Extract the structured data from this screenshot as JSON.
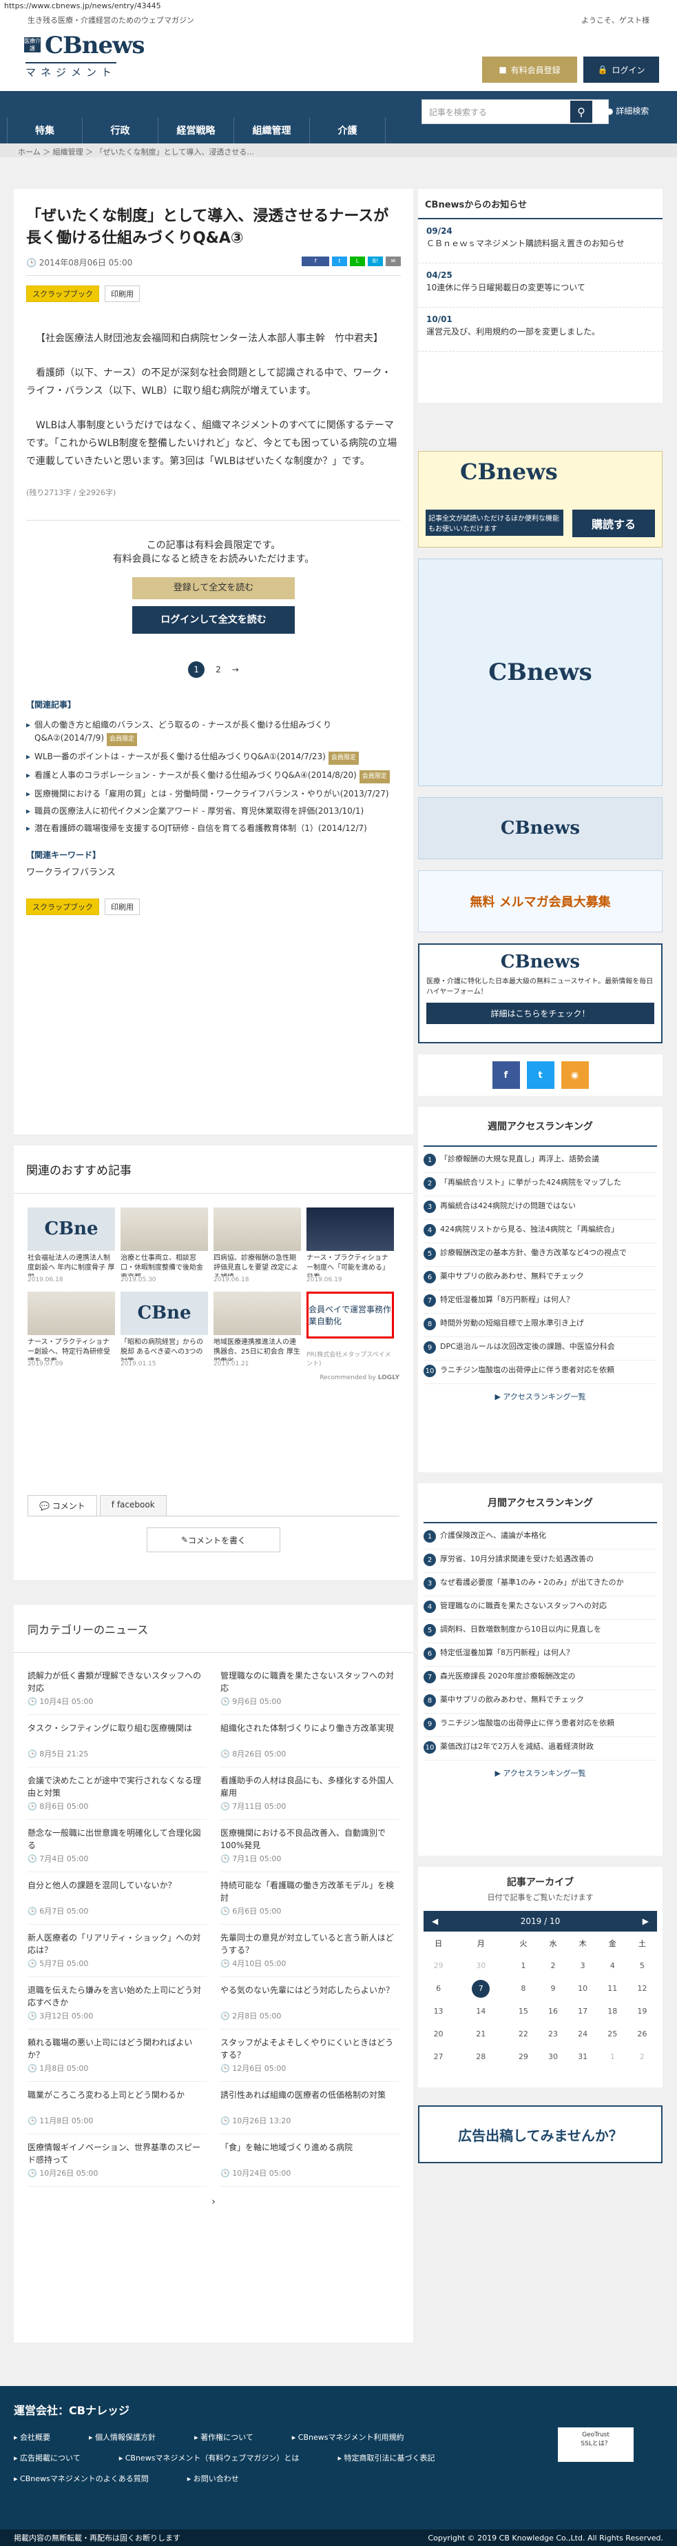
{
  "url": "https://www.cbnews.jp/news/entry/43445",
  "top": {
    "tagline": "生き残る医療・介護経営のためのウェブマガジン",
    "welcome": "ようこそ、ゲスト様"
  },
  "logo": {
    "badge": "医療介護",
    "name": "CBnews",
    "sub": "マネジメント"
  },
  "header": {
    "register": "有料会員登録",
    "login": "ログイン"
  },
  "nav": [
    "特集",
    "行政",
    "経営戦略",
    "組織管理",
    "介護"
  ],
  "search": {
    "placeholder": "記事を検索する",
    "advanced": "詳細検索"
  },
  "breadcrumb": "ホーム ＞ 組織管理 ＞ 「ぜいたくな制度」として導入、浸透させる...",
  "article": {
    "title": "「ぜいたくな制度」として導入、浸透させるナースが長く働ける仕組みづくりQ&A③",
    "date": "2014年08月06日 05:00",
    "scrap": "スクラップブック",
    "print": "印刷用",
    "author": "【社会医療法人財団池友会福岡和白病院センター法人本部人事主幹　竹中君夫】",
    "p1": "看護師（以下、ナース）の不足が深刻な社会問題として認識される中で、ワーク・ライフ・バランス（以下、WLB）に取り組む病院が増えています。",
    "p2": "WLBは人事制度というだけではなく、組織マネジメントのすべてに関係するテーマです。「これからWLB制度を整備したいけれど」など、今とても困っている病院の立場で連載していきたいと思います。第3回は「WLBはぜいたくな制度か？」です。",
    "remaining": "(残り2713字 / 全2926字)",
    "lock1": "この記事は有料会員限定です。",
    "lock2": "有料会員になると続きをお読みいただけます。",
    "btn_register": "登録して全文を読む",
    "btn_login": "ログインして全文を読む",
    "pages": [
      "1",
      "2",
      "→"
    ],
    "related_title": "【関連記事】",
    "related": [
      "個人の働き方と組織のバランス、どう取るの - ナースが長く働ける仕組みづくりQ&A②(2014/7/9)",
      "WLB一番のポイントは - ナースが長く働ける仕組みづくりQ&A①(2014/7/23)",
      "看護と人事のコラボレーション - ナースが長く働ける仕組みづくりQ&A④(2014/8/20)",
      "医療機関における「雇用の質」とは - 労働時間・ワークライフバランス・やりがい(2013/7/27)",
      "職員の医療法人に初代イクメン企業アワード - 厚労省、育児休業取得を評価(2013/10/1)",
      "潜在看護師の職場復帰を支援するOJT研修 - 自信を育てる看護教育体制（1）(2014/12/7)"
    ],
    "mini": "会員限定",
    "kw_title": "【関連キーワード】",
    "kw": "ワークライフバランス"
  },
  "rec": {
    "title": "関連のおすすめ記事",
    "items": [
      {
        "t": "社会福祉法人の連携法人制度創設へ 年内に制度骨子 厚労...",
        "d": "2019.06.18"
      },
      {
        "t": "治療と仕事両立、相談窓口・休暇制度整備で後助金 東京都...",
        "d": "2019.05.30"
      },
      {
        "t": "四病協、診療報酬の急性期評価見直しを要望 改定による補填...",
        "d": "2019.06.18"
      },
      {
        "t": "ナース・プラクティショナー制度へ「可能を進める」日看...",
        "d": "2019.06.19"
      },
      {
        "t": "ナース・プラクティショナー創設へ、特定行為研修受講を 日看...",
        "d": "2019.07.09"
      },
      {
        "t": "「昭和の病院経営」からの脱却 あるべき姿への3つの対策...",
        "d": "2019.01.15"
      },
      {
        "t": "地域医療連携推進法人の連携器合、25日に初会合 厚生労働省...",
        "d": "2019.01.21"
      },
      {
        "t": "会員ペイで運営事務作業自動化",
        "d": "PR(株式会社メタップスペイメント)"
      }
    ],
    "logly": "Recommended by"
  },
  "comments": {
    "tab1": "コメント",
    "tab2": "facebook",
    "write": "コメントを書く"
  },
  "news": {
    "title": "同カテゴリーのニュース",
    "items": [
      {
        "t": "読解力が低く書類が理解できないスタッフへの対応",
        "d": "10月4日 05:00"
      },
      {
        "t": "管理職なのに職責を果たさないスタッフへの対応",
        "d": "9月6日 05:00"
      },
      {
        "t": "タスク・シフティングに取り組む医療機関は",
        "d": "8月5日 21:25"
      },
      {
        "t": "組織化された体制づくりにより働き方改革実現",
        "d": "8月26日 05:00"
      },
      {
        "t": "会議で決めたことが途中で実行されなくなる理由と対策",
        "d": "8月6日 05:00"
      },
      {
        "t": "看護助手の人材は良品にも、多様化する外国人雇用",
        "d": "7月11日 05:00"
      },
      {
        "t": "懸念な一般職に出世意識を明確化して合理化図る",
        "d": "7月4日 05:00"
      },
      {
        "t": "医療機関における不良品改善入、自動識別で100%発見",
        "d": "7月1日 05:00"
      },
      {
        "t": "自分と他人の課題を混同していないか？",
        "d": "6月7日 05:00"
      },
      {
        "t": "持続可能な「看護職の働き方改革モデル」を検討",
        "d": "6月6日 05:00"
      },
      {
        "t": "新人医療者の「リアリティ・ショック」への対応は？",
        "d": "5月7日 05:00"
      },
      {
        "t": "先輩同士の意見が対立していると言う新人はどうする？",
        "d": "4月10日 05:00"
      },
      {
        "t": "退職を伝えたら嫌みを言い始めた上司にどう対応すべきか",
        "d": "3月12日 05:00"
      },
      {
        "t": "やる気のない先輩にはどう対応したらよいか？",
        "d": "2月8日 05:00"
      },
      {
        "t": "頼れる職場の悪い上司にはどう関わればよいか？",
        "d": "1月8日 05:00"
      },
      {
        "t": "スタッフがよそよそしくやりにくいときはどうする？",
        "d": "12月6日 05:00"
      },
      {
        "t": "職業がころころ変わる上司とどう関わるか",
        "d": "11月8日 05:00"
      },
      {
        "t": "誘引性あれば組織の医療者の低価格制の対策",
        "d": "10月26日 13:20"
      },
      {
        "t": "医療情報ギイノベーション、世界基準のスピード感持って",
        "d": "10月26日 05:00"
      },
      {
        "t": "「食」を軸に地域づくり進める病院",
        "d": "10月24日 05:00"
      }
    ]
  },
  "notice": {
    "title": "CBnewsからのお知らせ",
    "items": [
      {
        "d": "09/24",
        "t": "ＣＢｎｅｗｓマネジメント購読料据え置きのお知らせ"
      },
      {
        "d": "04/25",
        "t": "10連休に伴う日曜掲載日の変更等について"
      },
      {
        "d": "10/01",
        "t": "運営元及び、利用規約の一部を変更しました。"
      }
    ]
  },
  "ads": {
    "subscribe": "購読する",
    "sub_lead": "記事全文が試読いただけるほか便利な機能もお使いいただけます",
    "free": "無料 メルマガ会員大募集",
    "pr": "広告出稿してみませんか？"
  },
  "freebox": {
    "title": "医療・介護に特化した日本最大級の無料ニュースサイト。最新情報を毎日ハイヤーフォーム！",
    "btn": "詳細はこちらをチェック！"
  },
  "weekly": {
    "title": "週間アクセスランキング",
    "items": [
      "「診療報酬の大規な見直し」再浮上、語勢会議",
      "「再編統合リスト」に挙がった424病院をマップした",
      "再編統合は424病院だけの問題ではない",
      "424病院リストから見る、独法4病院と「再編統合」",
      "診療報酬改定の基本方針、働き方改革など4つの視点で",
      "薬中サプリの飲みあわせ、無料でチェック",
      "特定低湿養加算「8万円新程」は何人？",
      "時間外労動の短縮目標で上限水準引き上げ",
      "DPC退治ルールは次回改定後の課題、中医協分科会",
      "ラニチジン塩酸塩の出荷停止に伴う患者対応を依頼"
    ],
    "more": "アクセスランキング一覧"
  },
  "monthly": {
    "title": "月間アクセスランキング",
    "items": [
      "介護保険改正へ、議論が本格化",
      "厚労省、10月分請求関連を受けた処遇改善の",
      "なぜ看護必要度「基準1のみ・2のみ」が出てきたのか",
      "管理職なのに職責を果たさないスタッフへの対応",
      "調剤料、日数増数制度から10日以内に見直しを",
      "特定低湿養加算「8万円新程」は何人？",
      "森光医療課長 2020年度診療報酬改定の",
      "薬中サプリの飲みあわせ、無料でチェック",
      "ラニチジン塩酸塩の出荷停止に伴う患者対応を依頼",
      "薬価改訂は2年で2万人を減結、過着経済財政"
    ],
    "more": "アクセスランキング一覧"
  },
  "calendar": {
    "title": "記事アーカイブ",
    "sub": "日付で記事をご覧いただけます",
    "month": "2019 / 10",
    "dow": [
      "日",
      "月",
      "火",
      "水",
      "木",
      "金",
      "土"
    ],
    "rows": [
      [
        "29",
        "30",
        "1",
        "2",
        "3",
        "4",
        "5"
      ],
      [
        "6",
        "7",
        "8",
        "9",
        "10",
        "11",
        "12"
      ],
      [
        "13",
        "14",
        "15",
        "16",
        "17",
        "18",
        "19"
      ],
      [
        "20",
        "21",
        "22",
        "23",
        "24",
        "25",
        "26"
      ],
      [
        "27",
        "28",
        "29",
        "30",
        "31",
        "1",
        "2"
      ]
    ]
  },
  "footer": {
    "company": "運営会社：CBナレッジ",
    "links": [
      "会社概要",
      "個人情報保護方針",
      "著作権について",
      "CBnewsマネジメント利用規約",
      "広告掲載について",
      "CBnewsマネジメント（有料ウェブマガジン）とは",
      "特定商取引法に基づく表記",
      "CBnewsマネジメントのよくある質問",
      "お問い合わせ"
    ],
    "ssl": "SSLとは？",
    "bottom_left": "掲載内容の無断転載・再配布は固くお断りします",
    "copyright": "Copyright © 2019 CB Knowledge Co.,Ltd. All Rights Reserved."
  }
}
